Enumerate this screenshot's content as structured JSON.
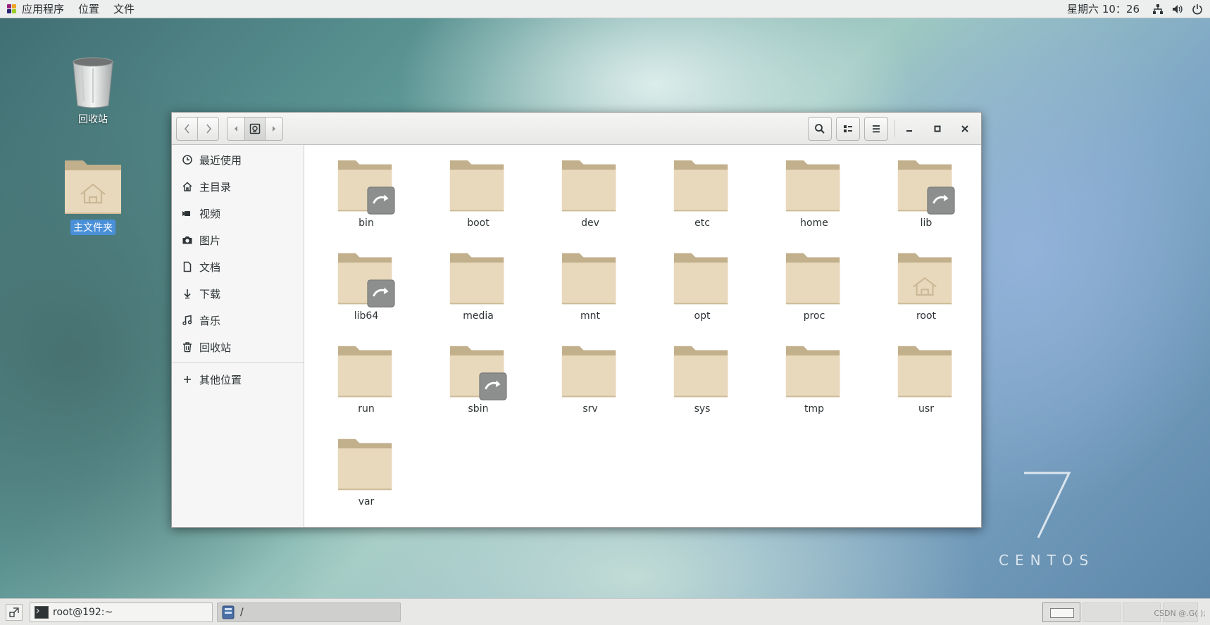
{
  "topbar": {
    "menus": [
      "应用程序",
      "位置",
      "文件"
    ],
    "clock": "星期六 10：26"
  },
  "desktop": {
    "trash_label": "回收站",
    "home_label": "主文件夹"
  },
  "brand": {
    "word": "CENTOS",
    "version": "7"
  },
  "window": {
    "path_icon": "drive-harddisk-icon",
    "sidebar": [
      {
        "label": "最近使用",
        "icon": "clock-icon"
      },
      {
        "label": "主目录",
        "icon": "home-icon"
      },
      {
        "label": "视频",
        "icon": "video-icon"
      },
      {
        "label": "图片",
        "icon": "camera-icon"
      },
      {
        "label": "文档",
        "icon": "document-icon"
      },
      {
        "label": "下载",
        "icon": "download-icon"
      },
      {
        "label": "音乐",
        "icon": "music-icon"
      },
      {
        "label": "回收站",
        "icon": "trash-icon"
      }
    ],
    "other_locations": "其他位置",
    "files": [
      {
        "name": "bin",
        "link": true
      },
      {
        "name": "boot",
        "link": false
      },
      {
        "name": "dev",
        "link": false
      },
      {
        "name": "etc",
        "link": false
      },
      {
        "name": "home",
        "link": false
      },
      {
        "name": "lib",
        "link": true
      },
      {
        "name": "lib64",
        "link": true
      },
      {
        "name": "media",
        "link": false
      },
      {
        "name": "mnt",
        "link": false
      },
      {
        "name": "opt",
        "link": false
      },
      {
        "name": "proc",
        "link": false
      },
      {
        "name": "root",
        "link": false,
        "home": true
      },
      {
        "name": "run",
        "link": false
      },
      {
        "name": "sbin",
        "link": true
      },
      {
        "name": "srv",
        "link": false
      },
      {
        "name": "sys",
        "link": false
      },
      {
        "name": "tmp",
        "link": false
      },
      {
        "name": "usr",
        "link": false
      },
      {
        "name": "var",
        "link": false
      }
    ]
  },
  "taskbar": {
    "tasks": [
      {
        "label": "root@192:~",
        "icon": "terminal-icon"
      },
      {
        "label": "/",
        "icon": "file-manager-icon"
      }
    ],
    "watermark": "CSDN @.G( );"
  },
  "colors": {
    "folder_back": "#c2b08c",
    "folder_front": "#e9d9bc",
    "selection": "#4a90d9"
  }
}
